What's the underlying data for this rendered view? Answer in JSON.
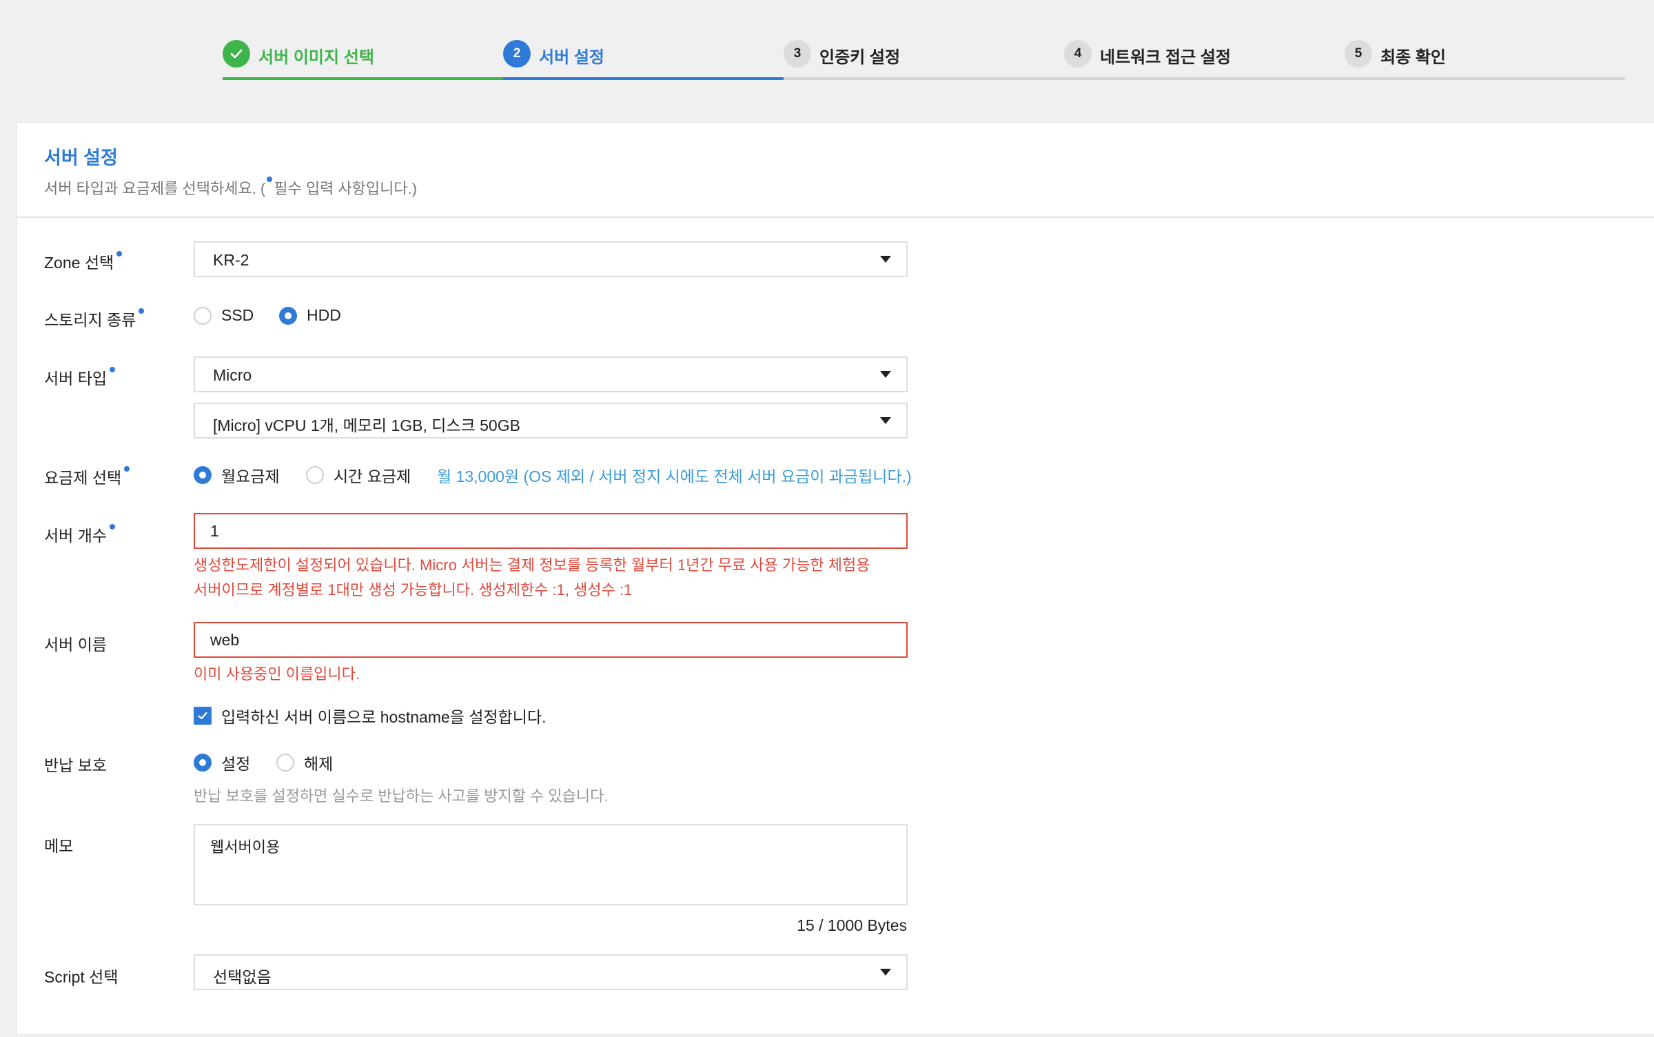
{
  "stepper": {
    "steps": [
      {
        "number": "",
        "label": "서버 이미지 선택",
        "state": "done"
      },
      {
        "number": "2",
        "label": "서버 설정",
        "state": "active"
      },
      {
        "number": "3",
        "label": "인증키 설정",
        "state": "todo"
      },
      {
        "number": "4",
        "label": "네트워크 접근 설정",
        "state": "todo"
      },
      {
        "number": "5",
        "label": "최종 확인",
        "state": "todo"
      }
    ]
  },
  "panel": {
    "title": "서버 설정",
    "desc_before": "서버 타입과 요금제를 선택하세요. (",
    "desc_after": "필수 입력 사항입니다.)"
  },
  "form": {
    "zone": {
      "label": "Zone 선택",
      "value": "KR-2"
    },
    "storage": {
      "label": "스토리지 종류",
      "options": [
        "SSD",
        "HDD"
      ],
      "selected": "HDD"
    },
    "server_type": {
      "label": "서버 타입",
      "type_value": "Micro",
      "spec_value": "[Micro] vCPU 1개, 메모리 1GB, 디스크 50GB"
    },
    "pricing": {
      "label": "요금제 선택",
      "options": [
        "월요금제",
        "시간 요금제"
      ],
      "selected": "월요금제",
      "info": "월 13,000원 (OS 제외 / 서버 정지 시에도 전체 서버 요금이 과금됩니다.)"
    },
    "server_count": {
      "label": "서버 개수",
      "value": "1",
      "error_line1": "생성한도제한이 설정되어 있습니다. Micro 서버는 결제 정보를 등록한 월부터 1년간 무료 사용 가능한 체험용",
      "error_line2": "서버이므로 계정별로 1대만 생성 가능합니다. 생성제한수 :1, 생성수 :1"
    },
    "server_name": {
      "label": "서버 이름",
      "value": "web",
      "error": "이미 사용중인 이름입니다.",
      "hostname_checkbox": "입력하신 서버 이름으로 hostname을 설정합니다."
    },
    "return_protect": {
      "label": "반납 보호",
      "options": [
        "설정",
        "해제"
      ],
      "selected": "설정",
      "hint": "반납 보호를 설정하면 실수로 반납하는 사고를 방지할 수 있습니다."
    },
    "memo": {
      "label": "메모",
      "value": "웹서버이용",
      "byte_count": "15 / 1000 Bytes"
    },
    "script": {
      "label": "Script 선택",
      "value": "선택없음"
    }
  },
  "colors": {
    "primary": "#2f7ad6",
    "success": "#3db54a",
    "error": "#e04a3c",
    "info": "#3b9bd8"
  }
}
